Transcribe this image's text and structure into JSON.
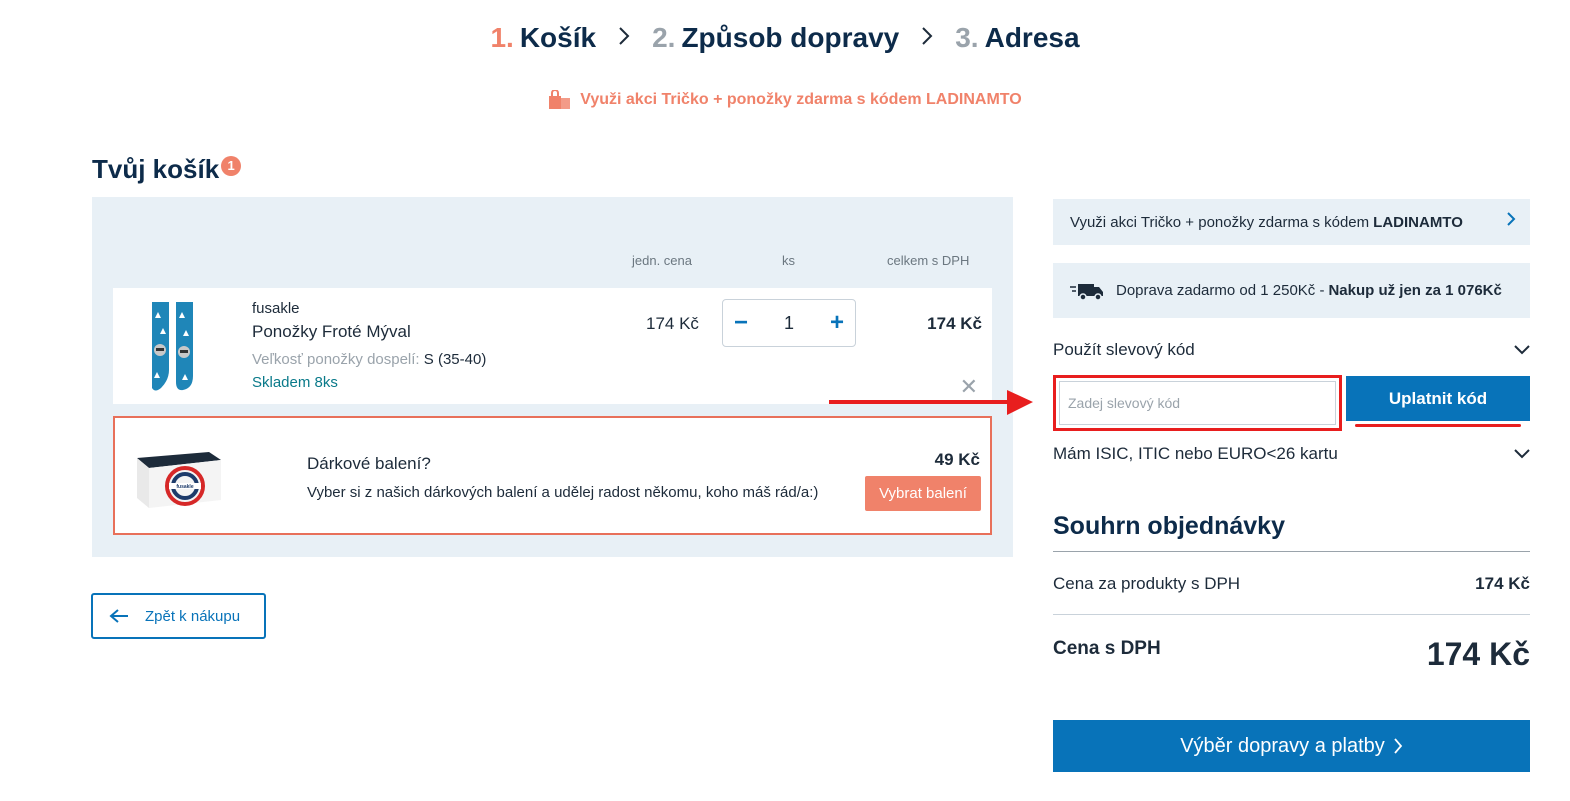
{
  "steps": [
    {
      "num": "1.",
      "label": "Košík"
    },
    {
      "num": "2.",
      "label": "Způsob dopravy"
    },
    {
      "num": "3.",
      "label": "Adresa"
    }
  ],
  "promo_banner": "Využi akci Tričko + ponožky zdarma s kódem LADINAMTO",
  "cart": {
    "title": "Tvůj košík",
    "count": "1",
    "headers": {
      "unit_price": "jedn. cena",
      "qty": "ks",
      "total": "celkem s DPH"
    },
    "item": {
      "brand": "fusakle",
      "name": "Ponožky Froté Mýval",
      "variant_label": "Veľkosť ponožky dospelí:",
      "variant_value": "S (35-40)",
      "stock": "Skladem 8ks",
      "unit_price": "174 Kč",
      "qty": "1",
      "minus": "−",
      "plus": "+",
      "total": "174 Kč",
      "remove": "✕"
    },
    "gift": {
      "title": "Dárkové balení?",
      "desc": "Vyber si z našich dárkových balení a udělej radost někomu, koho máš rád/a:)",
      "price": "49 Kč",
      "button": "Vybrat balení",
      "box_brand": "fusakle"
    },
    "back_button": "Zpět k nákupu"
  },
  "sidebar": {
    "promo_text": "Využi akci Tričko + ponožky zdarma s kódem",
    "promo_code": "LADINAMTO",
    "shipping_text": "Doprava zadarmo od 1 250Kč -",
    "shipping_bold": "Nakup už jen za 1 076Kč",
    "coupon_toggle": "Použít slevový kód",
    "coupon_placeholder": "Zadej slevový kód",
    "coupon_button": "Uplatnit kód",
    "isic_toggle": "Mám ISIC, ITIC nebo EURO<26 kartu",
    "summary_title": "Souhrn objednávky",
    "products_label": "Cena za produkty s DPH",
    "products_value": "174 Kč",
    "total_label": "Cena s DPH",
    "total_value": "174 Kč",
    "checkout_button": "Výběr dopravy a platby"
  },
  "colors": {
    "brand_blue": "#0873b9",
    "accent_salmon": "#f0826a",
    "panel_bg": "#e8f0f6",
    "annotation_red": "#e81e1e"
  }
}
